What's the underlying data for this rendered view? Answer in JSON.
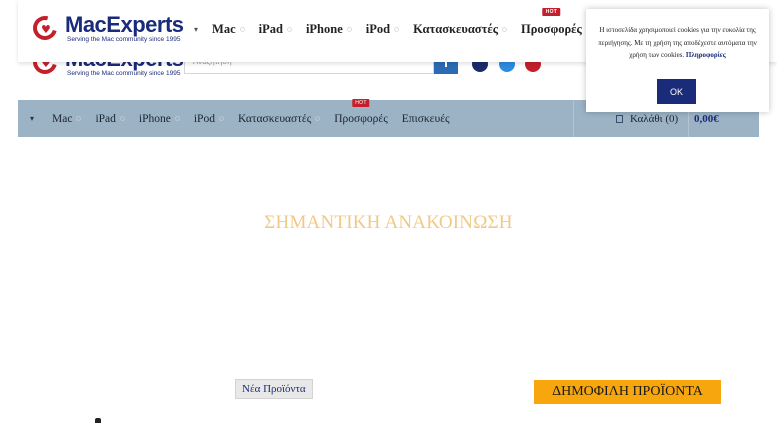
{
  "brand": {
    "name": "MacExperts",
    "tagline": "Serving the Mac community since 1995"
  },
  "search": {
    "placeholder": "Αναζήτηση"
  },
  "nav": {
    "items": [
      {
        "label": "Mac"
      },
      {
        "label": "iPad"
      },
      {
        "label": "iPhone"
      },
      {
        "label": "iPod"
      },
      {
        "label": "Κατασκευαστές"
      },
      {
        "label": "Προσφορές",
        "badge": "HOT"
      },
      {
        "label": "Επισκευές"
      }
    ]
  },
  "cart": {
    "label": "Καλάθι (0)",
    "total": "0,00€"
  },
  "social_colors": [
    "#1a2b6a",
    "#2d8be0",
    "#c4202b"
  ],
  "colors": {
    "brand_blue": "#1a2b7a",
    "brand_red": "#c4202b",
    "nav_bg": "#9cb3c6",
    "announcement": "#f1c985",
    "popular_bg": "#f7a60e"
  },
  "main": {
    "announcement": "ΣΗΜΑΝΤΙΚΗ ΑΝΑΚΟΙΝΩΣΗ",
    "new_products_tab": "Νέα Προϊόντα",
    "popular_heading": "ΔΗΜΟΦΙΛΗ ΠΡΟΪΟΝΤΑ"
  },
  "cookie": {
    "message": "Η ιστοσελίδα χρησιμοποιεί cookies για την ευκολία της περιήγησης. Με τη χρήση της αποδέχεστε αυτόματα την χρήση των cookies.",
    "more_link": "Πληροφορίες",
    "ok_label": "OK"
  }
}
